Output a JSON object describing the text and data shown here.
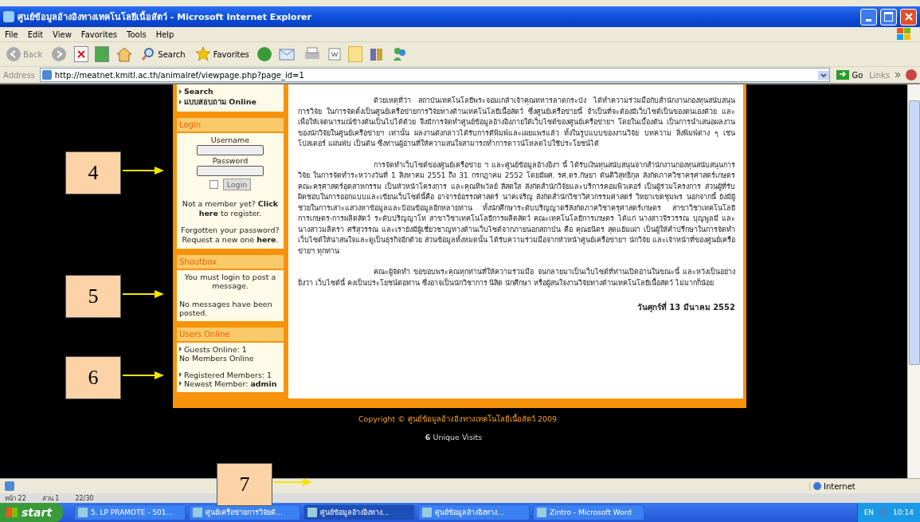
{
  "window": {
    "title": "ศูนย์ข้อมูลอ้างอิงทางเทคโนโลยีเนื้อสัตว์ - Microsoft Internet Explorer"
  },
  "menu": [
    "File",
    "Edit",
    "View",
    "Favorites",
    "Tools",
    "Help"
  ],
  "toolbar": {
    "back": "Back",
    "search": "Search",
    "favorites": "Favorites"
  },
  "address": {
    "label": "Address",
    "url": "http://meatnet.kmitl.ac.th/animalref/viewpage.php?page_id=1",
    "go": "Go",
    "links": "Links"
  },
  "sidebar": {
    "nav": [
      "Search",
      "แบบสอบถาม Online"
    ],
    "login": {
      "title": "Login",
      "username_label": "Username",
      "password_label": "Password",
      "remember_checked": false,
      "button": "Login",
      "register": "Not a member yet? **Click here** to register.",
      "forgot": "Forgotten your password? Request a new one **here**."
    },
    "shoutbox": {
      "title": "Shoutbox",
      "notice": "You must login to post a message.",
      "empty": "No messages have been posted."
    },
    "users_online": {
      "title": "Users Online",
      "groups": [
        [
          {
            "text": "Guests Online: 1",
            "bullet": true
          },
          {
            "text": "No Members Online",
            "bullet": false
          }
        ],
        [
          {
            "text": "Registered Members: 1",
            "bullet": true
          },
          {
            "text": "Newest Member: **admin**",
            "bullet": true
          }
        ]
      ]
    }
  },
  "article": {
    "paragraphs": [
      "ด้วยเหตุที่ว่า สถาบันเทคโนโลยีพระจอมเกล้าเจ้าคุณทหารลาดกระบัง ได้ทำความร่วมมือกับสำนักงานกองทุนสนับสนุนการวิจัย ในการจัดตั้งเป็นศูนย์เครือข่ายการวิจัยทางด้านเทคโนโลยีเนื้อสัตว์ ซึ่งศูนย์เครือข่ายนี้ จำเป็นที่จะต้องมีเว็บไซต์เป็นของตนเองด้วย และเพื่อให้เจตนารมณ์ข้างต้นเป็นไปได้ด้วย จึงมีการจัดทำศูนย์ข้อมูลอ้างอิงภายใต้เว็บไซต์ของศูนย์เครือข่ายฯ โดยในเบื้องต้น เป็นการนำเสนอผลงานของนักวิจัยในศูนย์เครือข่ายฯ เท่านั้น ผลงานดังกล่าวได้รับการตีพิมพ์และเผยแพร่แล้ว ทั้งในรูปแบบของงานวิจัย บทความ สิ่งพิมพ์ต่าง ๆ เช่น โปสเตอร์ แผ่นพับ เป็นต้น ซึ่งท่านผู้อ่านที่ให้ความสนใจสามารถทำการดาวน์โหลดไปใช้ประโยชน์ได้",
      "การจัดทำเว็บไซต์ของศูนย์เครือข่าย ฯ และศูนย์ข้อมูลอ้างอิงฯ นี้ ได้รับเงินทุนสนับสนุนจากสำนักงานกองทุนสนับสนุนการวิจัย ในการจัดทำระหว่างวันที่ 1 สิงหาคม 2551 ถึง 31 กรกฎาคม 2552 โดยมีผศ. รศ.ดร.กัษยา ตันติวิสุทธิกุล สังกัดภาควิชาครุศาสตร์เกษตร คณะครุศาสตร์อุตสาหกรรม เป็นหัวหน้าโครงการ และคุณทิพวัลย์ สีสดใส สังกัดสำนักวิจัยและบริการคอมพิวเตอร์ เป็นผู้ร่วมโครงการ ส่วนผู้ที่รับผิดชอบในการออกแบบและเขียนเว็บไซต์นี้คือ อาจารย์อรรถศาสตร์ นาคเจริญ สังกัดสำนักวิชาวิศวกรรมศาสตร์ วิทยาเขตชุมพร นอกจากนี้ ยังมีผู้ช่วยในการเสาะแสวงหาข้อมูลและป้อนข้อมูลอีกหลายท่าน ทั้งนักศึกษาระดับปริญญาตรีสังกัดภาควิชาครุศาสตร์เกษตร สาขาวิชาเทคโนโลยีการเกษตร-การผลิตสัตว์ ระดับปริญญาโท สาขาวิชาเทคโนโลยีการผลิตสัตว์ คณะเทคโนโลยีการเกษตร ได้แก่ นางสาวจีรวรรณ บุญพูลมี และนางสาวมลิตรา ศรีสุวรรณ และเรายังมีผู้เชี่ยวชาญทางด้านเว็บไซต์จากภายนอกสถาบัน คือ คุณธนิตร สุดแย้มเผ่า เป็นผู้ให้คำปรึกษาในการจัดทำเว็บไซต์ให้น่าสนใจและดูเป็นธุรกิจอีกด้วย ส่วนข้อมูลทั้งหมดนั้น ได้รับความร่วมมือจากหัวหน้าศูนย์เครือข่ายฯ นักวิจัย และเจ้าหน้าที่ของศูนย์เครือข่ายฯ ทุกท่าน",
      "คณะผู้จัดทำ ขอขอบพระคุณทุกท่านที่ให้ความร่วมมือ จนกลายมาเป็นเว็บไซต์ที่ท่านเปิดอ่านในขณะนี้ และหวังเป็นอย่างยิ่งว่า เว็บไซต์นี้ คงเป็นประโยชน์ต่อท่าน ซึ่งอาจเป็นนักวิชาการ นิสิต นักศึกษา หรือผู้สนใจงานวิจัยทางด้านเทคโนโลยีเนื้อสัตว์ ไม่มากก็น้อย"
    ],
    "date": "วันศุกร์ที่ 13 มีนาคม 2552"
  },
  "footer": {
    "copyright": "Copyright © ศูนย์ข้อมูลอ้างอิงทางเทคโนโลยีเนื้อสัตว์ 2009",
    "visits": "**6** Unique Visits"
  },
  "callouts": [
    {
      "number": "4"
    },
    {
      "number": "5"
    },
    {
      "number": "6"
    },
    {
      "number": "7"
    }
  ],
  "status_bar": {
    "zone": "Internet"
  },
  "word_status": [
    "หน้า 22",
    "ส่วน 1",
    "22/30"
  ],
  "taskbar": {
    "start": "start",
    "tasks": [
      {
        "label": "5. LP PRAMOTE - 501...",
        "selected": false
      },
      {
        "label": "ศูนย์เครือข่ายการวิจัยด้...",
        "selected": false
      },
      {
        "label": "ศูนย์ข้อมูลอ้างอิงทาง...",
        "selected": true
      },
      {
        "label": "ศูนย์ข้อมูลอ้างอิงทาง...",
        "selected": false
      },
      {
        "label": "Zintro - Microsoft Word",
        "selected": false
      }
    ],
    "lang": "EN",
    "clock": "10:14"
  }
}
